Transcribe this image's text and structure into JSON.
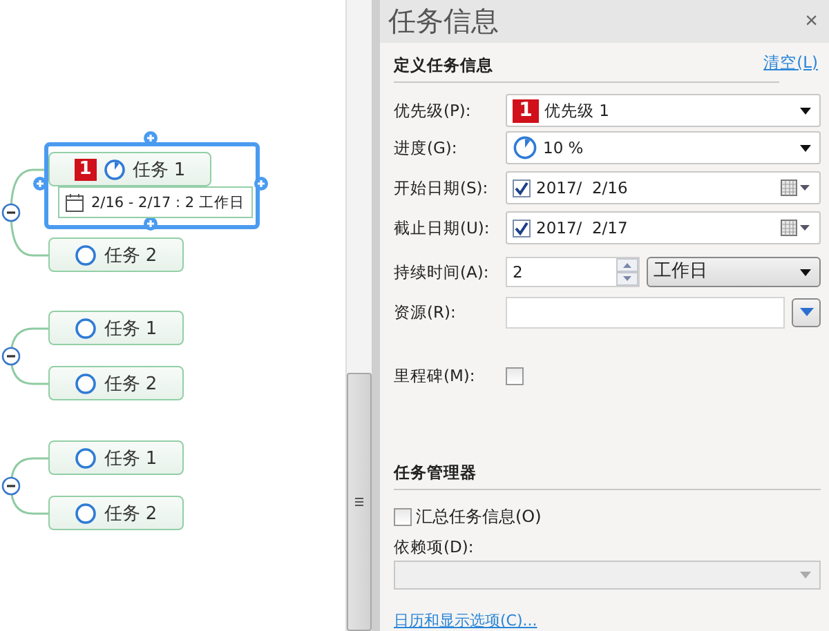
{
  "canvas": {
    "groups": [
      {
        "expanded": true,
        "tasks": [
          {
            "label": "任务 1",
            "selected": true,
            "priority": "1",
            "started": true,
            "schedule": "2/16 - 2/17 : 2 工作日"
          },
          {
            "label": "任务 2",
            "selected": false,
            "started": false
          }
        ]
      },
      {
        "expanded": true,
        "tasks": [
          {
            "label": "任务 1",
            "selected": false,
            "started": false
          },
          {
            "label": "任务 2",
            "selected": false,
            "started": false
          }
        ]
      },
      {
        "expanded": true,
        "tasks": [
          {
            "label": "任务 1",
            "selected": false,
            "started": false
          },
          {
            "label": "任务 2",
            "selected": false,
            "started": false
          }
        ]
      }
    ]
  },
  "panel": {
    "title": "任务信息",
    "close": "×",
    "define": {
      "heading": "定义任务信息",
      "clear_link": "清空(L)",
      "fields": [
        {
          "kind": "priority",
          "label": "优先级(P):",
          "badge": "1",
          "value": "优先级 1"
        },
        {
          "kind": "progress",
          "label": "进度(G):",
          "started": true,
          "value": "10 %"
        },
        {
          "kind": "date",
          "label": "开始日期(S):",
          "checked": true,
          "value": "2017/  2/16"
        },
        {
          "kind": "date",
          "label": "截止日期(U):",
          "checked": true,
          "value": "2017/  2/17"
        },
        {
          "kind": "duration",
          "label": "持续时间(A):",
          "value": "2",
          "unit": "工作日"
        },
        {
          "kind": "resource",
          "label": "资源(R):"
        },
        {
          "kind": "milestone",
          "label": "里程碑(M):",
          "checked": false
        }
      ]
    },
    "manager": {
      "heading": "任务管理器",
      "rollup": {
        "label": "汇总任务信息(O)",
        "checked": false
      },
      "dependency": {
        "label": "依赖项(D):",
        "disabled": true
      }
    },
    "options_link": "日历和显示选项(C)..."
  }
}
